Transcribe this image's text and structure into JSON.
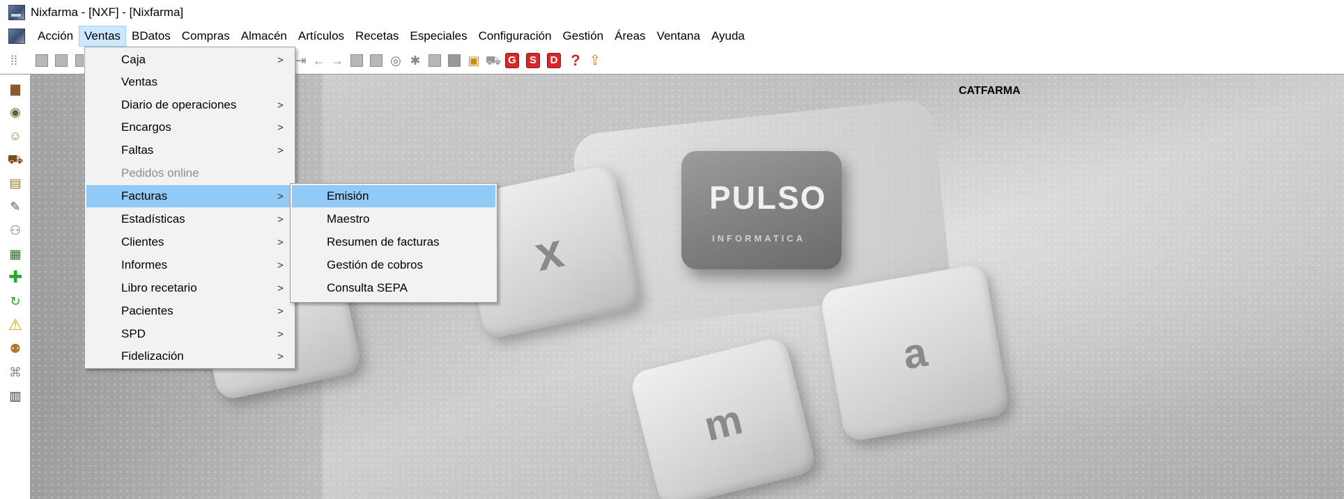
{
  "window": {
    "title": "Nixfarma - [NXF] - [Nixfarma]"
  },
  "menubar": {
    "items": [
      {
        "label": "Acción"
      },
      {
        "label": "Ventas",
        "active": true
      },
      {
        "label": "BDatos"
      },
      {
        "label": "Compras"
      },
      {
        "label": "Almacén"
      },
      {
        "label": "Artículos"
      },
      {
        "label": "Recetas"
      },
      {
        "label": "Especiales"
      },
      {
        "label": "Configuración"
      },
      {
        "label": "Gestión"
      },
      {
        "label": "Áreas"
      },
      {
        "label": "Ventana"
      },
      {
        "label": "Ayuda"
      }
    ]
  },
  "toolbar": {
    "letter_buttons": [
      "G",
      "S",
      "D"
    ],
    "help_label": "?"
  },
  "workspace": {
    "brand_label": "CATFARMA",
    "key_logo_text": "PULSO",
    "key_logo_sub": "INFORMATICA",
    "key_letters": [
      "x",
      "a",
      "m"
    ]
  },
  "ventas_menu": {
    "items": [
      {
        "label": "Caja",
        "submenu": true
      },
      {
        "label": "Ventas",
        "submenu": false
      },
      {
        "label": "Diario de operaciones",
        "submenu": true
      },
      {
        "label": "Encargos",
        "submenu": true
      },
      {
        "label": "Faltas",
        "submenu": true
      },
      {
        "label": "Pedidos online",
        "submenu": false,
        "disabled": true
      },
      {
        "label": "Facturas",
        "submenu": true,
        "highlight": true
      },
      {
        "label": "Estadísticas",
        "submenu": true
      },
      {
        "label": "Clientes",
        "submenu": true
      },
      {
        "label": "Informes",
        "submenu": true
      },
      {
        "label": "Libro recetario",
        "submenu": true
      },
      {
        "label": "Pacientes",
        "submenu": true
      },
      {
        "label": "SPD",
        "submenu": true
      },
      {
        "label": "Fidelización",
        "submenu": true
      }
    ],
    "arrow_glyph": ">"
  },
  "facturas_submenu": {
    "items": [
      {
        "label": "Emisión",
        "highlight": true
      },
      {
        "label": "Maestro"
      },
      {
        "label": "Resumen de facturas"
      },
      {
        "label": "Gestión de cobros"
      },
      {
        "label": "Consulta SEPA"
      }
    ]
  }
}
